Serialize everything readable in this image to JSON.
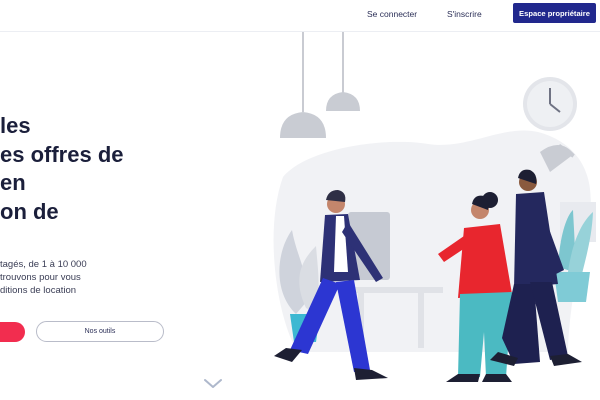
{
  "header": {
    "login_label": "Se connecter",
    "signup_label": "S'inscrire",
    "owner_button_label": "Espace propriétaire",
    "owner_button_color": "#21288d"
  },
  "hero": {
    "headline_lines": [
      "les",
      "es offres de",
      "en",
      "on de"
    ],
    "paragraph_lines": [
      "tagés, de 1 à 10 000",
      "trouvons pour vous",
      "ditions de location"
    ],
    "primary_button_color": "#f22d4f",
    "secondary_button_label": "Nos outils"
  },
  "icons": {
    "scroll": "chevron-down-icon",
    "clock": "clock-icon",
    "lamp": "pendant-lamp-icon"
  }
}
